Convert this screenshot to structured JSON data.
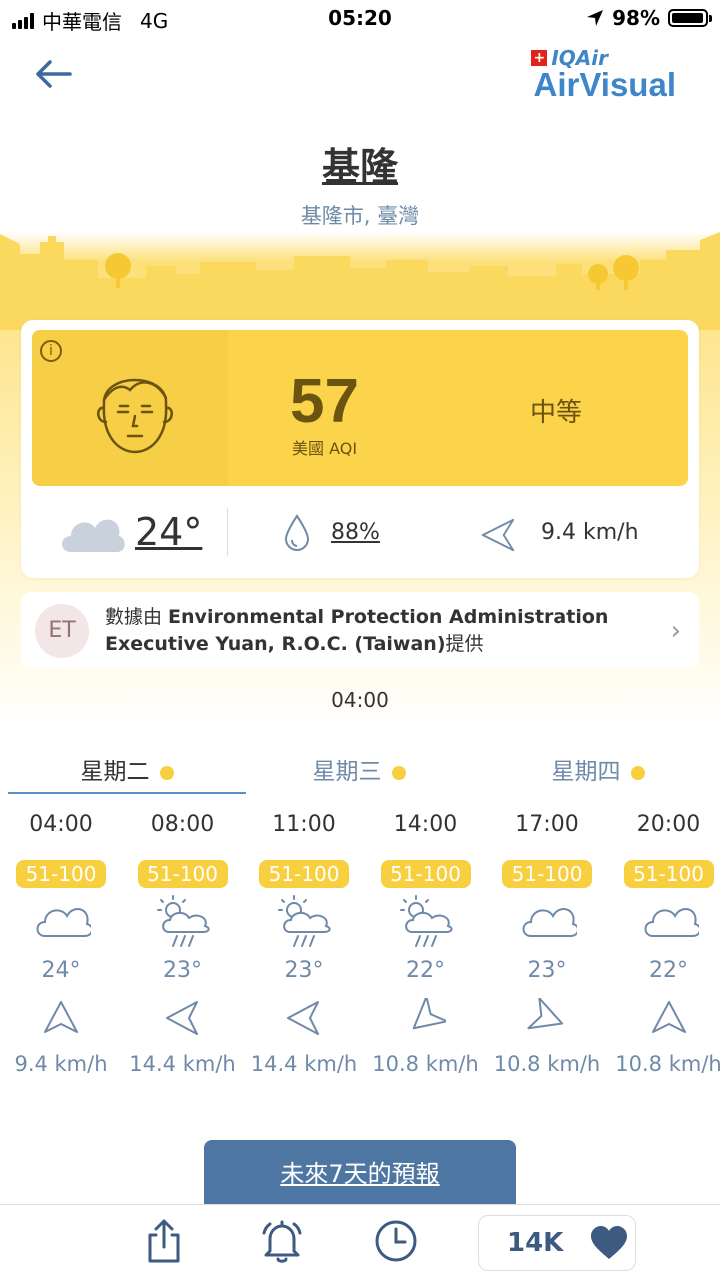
{
  "status_bar": {
    "carrier": "中華電信",
    "network": "4G",
    "time": "05:20",
    "battery": "98%",
    "battery_level": 0.98
  },
  "header": {
    "brand_top": "IQAir",
    "brand_main": "AirVisual"
  },
  "city": {
    "name": "基隆",
    "subtitle": "基隆市, 臺灣"
  },
  "aqi": {
    "value": "57",
    "label": "美國 AQI",
    "level": "中等",
    "color": "#fbd44b"
  },
  "weather": {
    "temperature": "24°",
    "humidity": "88%",
    "wind": "9.4 km/h"
  },
  "source": {
    "initials": "ET",
    "prefix": "數據由 ",
    "name": "Environmental Protection Administration Executive Yuan, R.O.C. (Taiwan)",
    "suffix": "提供"
  },
  "updated_time": "04:00",
  "tabs": [
    {
      "label": "星期二",
      "active": true
    },
    {
      "label": "星期三",
      "active": false
    },
    {
      "label": "星期四",
      "active": false
    }
  ],
  "hourly": [
    {
      "time": "04:00",
      "aqi": "51-100",
      "icon": "cloud-icon",
      "temp": "24°",
      "wind": "9.4 km/h",
      "wind_dir": 90
    },
    {
      "time": "08:00",
      "aqi": "51-100",
      "icon": "sun-rain-icon",
      "temp": "23°",
      "wind": "14.4 km/h",
      "wind_dir": 0
    },
    {
      "time": "11:00",
      "aqi": "51-100",
      "icon": "sun-rain-icon",
      "temp": "23°",
      "wind": "14.4 km/h",
      "wind_dir": 0
    },
    {
      "time": "14:00",
      "aqi": "51-100",
      "icon": "sun-rain-icon",
      "temp": "22°",
      "wind": "10.8 km/h",
      "wind_dir": -40
    },
    {
      "time": "17:00",
      "aqi": "51-100",
      "icon": "cloud-icon",
      "temp": "23°",
      "wind": "10.8 km/h",
      "wind_dir": 200
    },
    {
      "time": "20:00",
      "aqi": "51-100",
      "icon": "cloud-icon",
      "temp": "22°",
      "wind": "10.8 km/h",
      "wind_dir": 90
    }
  ],
  "forecast_button": "未來7天的預報",
  "likes": "14K",
  "colors": {
    "accent": "#4e76a2",
    "aqi_yellow": "#fbd44b",
    "muted_blue": "#6f8aa8",
    "brand_blue": "#3f86c8"
  }
}
